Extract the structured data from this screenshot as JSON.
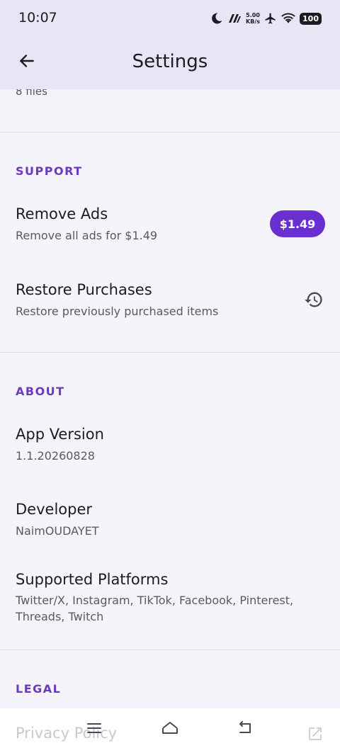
{
  "status_bar": {
    "time": "10:07",
    "net_speed_value": "5.00",
    "net_speed_unit": "KB/s",
    "battery": "100",
    "icons": [
      "moon-icon",
      "network-logo-icon",
      "airplane-icon",
      "wifi-icon",
      "battery-icon"
    ]
  },
  "app_bar": {
    "title": "Settings",
    "back_icon": "arrow-left-icon"
  },
  "storage_partial": {
    "text": "8 files"
  },
  "support": {
    "header": "SUPPORT",
    "remove_ads": {
      "title": "Remove Ads",
      "subtitle": "Remove all ads for $1.49",
      "price_label": "$1.49"
    },
    "restore": {
      "title": "Restore Purchases",
      "subtitle": "Restore previously purchased items",
      "icon": "restore-history-icon"
    }
  },
  "about": {
    "header": "ABOUT",
    "app_version": {
      "title": "App Version",
      "value": "1.1.20260828"
    },
    "developer": {
      "title": "Developer",
      "value": "NaimOUDAYET"
    },
    "platforms": {
      "title": "Supported Platforms",
      "value": "Twitter/X, Instagram, TikTok, Facebook, Pinterest, Threads, Twitch"
    }
  },
  "legal": {
    "header": "LEGAL",
    "privacy_policy": {
      "title": "Privacy Policy",
      "icon": "open-external-icon"
    }
  },
  "nav_bar": {
    "icons": [
      "menu-icon",
      "home-icon",
      "back-nav-icon"
    ]
  },
  "colors": {
    "accent": "#6a3bc2",
    "button": "#6a2fd1",
    "app_bar_bg": "#e8e5f5",
    "page_bg": "#f5f4fa"
  }
}
